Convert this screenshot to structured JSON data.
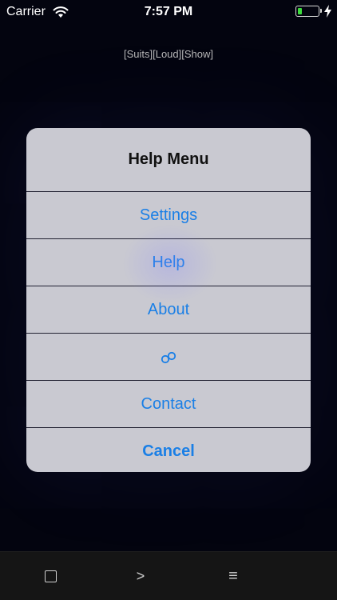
{
  "status_bar": {
    "carrier": "Carrier",
    "time": "7:57 PM",
    "wifi_icon": "wifi-icon",
    "battery_icon": "battery-icon",
    "charging_icon": "bolt-icon",
    "battery_level": 0.2
  },
  "game": {
    "tags": "[Suits][Loud][Show]"
  },
  "alert": {
    "title": "Help Menu",
    "items": [
      {
        "label": "Settings"
      },
      {
        "label": "Help"
      },
      {
        "label": "About"
      },
      {
        "label": "",
        "icon": "link-icon"
      },
      {
        "label": "Contact"
      }
    ],
    "cancel_label": "Cancel"
  },
  "toolbar": {
    "square_icon": "square-icon",
    "next_label": ">",
    "menu_label": "≡"
  },
  "colors": {
    "background": "#03040f",
    "alert_bg": "#c9c9d1",
    "accent": "#1a7fe6",
    "battery": "#3ddc3d"
  }
}
